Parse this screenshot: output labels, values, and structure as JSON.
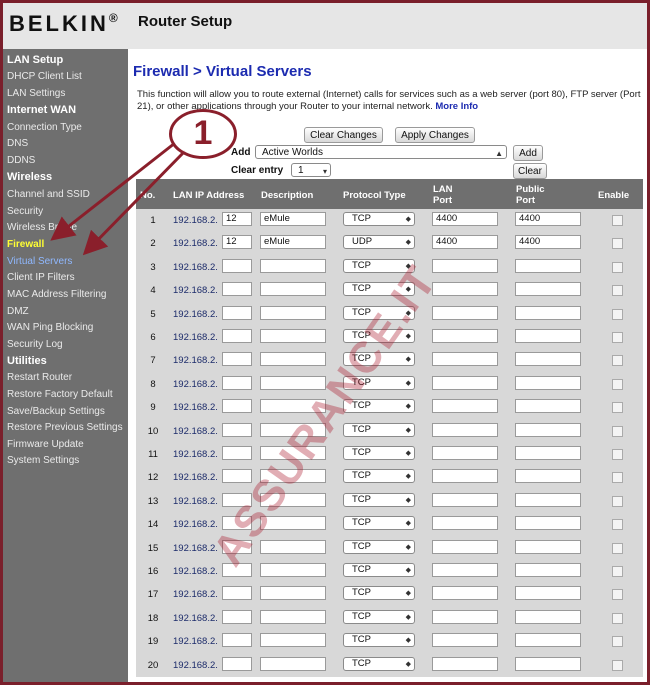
{
  "header": {
    "brand": "BELKIN",
    "brand_mark": "®",
    "title": "Router Setup"
  },
  "sidebar": {
    "items": [
      {
        "label": "LAN Setup",
        "kind": "section"
      },
      {
        "label": "DHCP Client List",
        "kind": "item"
      },
      {
        "label": "LAN Settings",
        "kind": "item"
      },
      {
        "label": "Internet WAN",
        "kind": "section"
      },
      {
        "label": "Connection Type",
        "kind": "item"
      },
      {
        "label": "DNS",
        "kind": "item"
      },
      {
        "label": "DDNS",
        "kind": "item"
      },
      {
        "label": "Wireless",
        "kind": "section"
      },
      {
        "label": "Channel and SSID",
        "kind": "item"
      },
      {
        "label": "Security",
        "kind": "item"
      },
      {
        "label": "Wireless Bridge",
        "kind": "item"
      },
      {
        "label": "Firewall",
        "kind": "active"
      },
      {
        "label": "Virtual Servers",
        "kind": "link"
      },
      {
        "label": "Client IP Filters",
        "kind": "item"
      },
      {
        "label": "MAC Address Filtering",
        "kind": "item"
      },
      {
        "label": "DMZ",
        "kind": "item"
      },
      {
        "label": "WAN Ping Blocking",
        "kind": "item"
      },
      {
        "label": "Security Log",
        "kind": "item"
      },
      {
        "label": "Utilities",
        "kind": "section"
      },
      {
        "label": "Restart Router",
        "kind": "item"
      },
      {
        "label": "Restore Factory Default",
        "kind": "item"
      },
      {
        "label": "Save/Backup Settings",
        "kind": "item"
      },
      {
        "label": "Restore Previous Settings",
        "kind": "item"
      },
      {
        "label": "Firmware Update",
        "kind": "item"
      },
      {
        "label": "System Settings",
        "kind": "item"
      }
    ]
  },
  "main": {
    "title": "Firewall > Virtual Servers",
    "description": "This function will allow you to route external (Internet) calls for services such as a web server (port 80), FTP server (Port 21), or other applications through your Router to your internal network.",
    "more_info": "More Info",
    "buttons": {
      "clear_changes": "Clear Changes",
      "apply_changes": "Apply Changes",
      "add": "Add",
      "clear": "Clear"
    },
    "add_label": "Add",
    "add_select": "Active Worlds",
    "clear_entry_label": "Clear entry",
    "clear_entry_select": "1"
  },
  "table": {
    "headers": {
      "no": "No.",
      "lan_ip": "LAN IP Address",
      "description": "Description",
      "protocol": "Protocol Type",
      "lan_port": "LAN Port",
      "public_port": "Public Port",
      "enable": "Enable"
    },
    "ip_prefix": "192.168.2.",
    "rows": [
      {
        "no": "1",
        "ip": "12",
        "desc": "eMule",
        "proto": "TCP",
        "lan_port": "4400",
        "pub_port": "4400"
      },
      {
        "no": "2",
        "ip": "12",
        "desc": "eMule",
        "proto": "UDP",
        "lan_port": "4400",
        "pub_port": "4400"
      },
      {
        "no": "3",
        "ip": "",
        "desc": "",
        "proto": "TCP",
        "lan_port": "",
        "pub_port": ""
      },
      {
        "no": "4",
        "ip": "",
        "desc": "",
        "proto": "TCP",
        "lan_port": "",
        "pub_port": ""
      },
      {
        "no": "5",
        "ip": "",
        "desc": "",
        "proto": "TCP",
        "lan_port": "",
        "pub_port": ""
      },
      {
        "no": "6",
        "ip": "",
        "desc": "",
        "proto": "TCP",
        "lan_port": "",
        "pub_port": ""
      },
      {
        "no": "7",
        "ip": "",
        "desc": "",
        "proto": "TCP",
        "lan_port": "",
        "pub_port": ""
      },
      {
        "no": "8",
        "ip": "",
        "desc": "",
        "proto": "TCP",
        "lan_port": "",
        "pub_port": ""
      },
      {
        "no": "9",
        "ip": "",
        "desc": "",
        "proto": "TCP",
        "lan_port": "",
        "pub_port": ""
      },
      {
        "no": "10",
        "ip": "",
        "desc": "",
        "proto": "TCP",
        "lan_port": "",
        "pub_port": ""
      },
      {
        "no": "11",
        "ip": "",
        "desc": "",
        "proto": "TCP",
        "lan_port": "",
        "pub_port": ""
      },
      {
        "no": "12",
        "ip": "",
        "desc": "",
        "proto": "TCP",
        "lan_port": "",
        "pub_port": ""
      },
      {
        "no": "13",
        "ip": "",
        "desc": "",
        "proto": "TCP",
        "lan_port": "",
        "pub_port": ""
      },
      {
        "no": "14",
        "ip": "",
        "desc": "",
        "proto": "TCP",
        "lan_port": "",
        "pub_port": ""
      },
      {
        "no": "15",
        "ip": "",
        "desc": "",
        "proto": "TCP",
        "lan_port": "",
        "pub_port": ""
      },
      {
        "no": "16",
        "ip": "",
        "desc": "",
        "proto": "TCP",
        "lan_port": "",
        "pub_port": ""
      },
      {
        "no": "17",
        "ip": "",
        "desc": "",
        "proto": "TCP",
        "lan_port": "",
        "pub_port": ""
      },
      {
        "no": "18",
        "ip": "",
        "desc": "",
        "proto": "TCP",
        "lan_port": "",
        "pub_port": ""
      },
      {
        "no": "19",
        "ip": "",
        "desc": "",
        "proto": "TCP",
        "lan_port": "",
        "pub_port": ""
      },
      {
        "no": "20",
        "ip": "",
        "desc": "",
        "proto": "TCP",
        "lan_port": "",
        "pub_port": ""
      }
    ]
  },
  "overlay": {
    "callout_number": "1",
    "watermark": "ASSURANCE.IT"
  },
  "colors": {
    "frame": "#7a1f2b",
    "sidebar": "#6f6f6f",
    "title_blue": "#1c2bb0",
    "active_item": "#ffff33",
    "link_item": "#8fb8ff"
  }
}
